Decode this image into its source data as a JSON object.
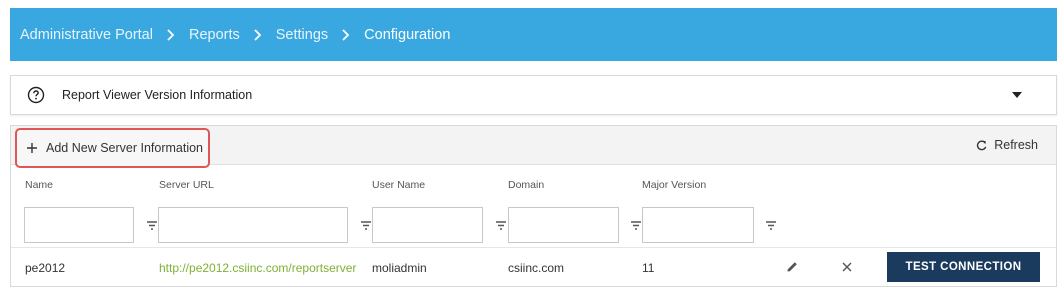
{
  "breadcrumb": {
    "items": [
      {
        "label": "Administrative Portal"
      },
      {
        "label": "Reports"
      },
      {
        "label": "Settings"
      },
      {
        "label": "Configuration"
      }
    ]
  },
  "version_panel": {
    "title": "Report Viewer Version Information",
    "icon": "help-circle-icon",
    "expand_icon": "caret-down-icon"
  },
  "toolbar": {
    "add_label": "Add New Server Information",
    "refresh_label": "Refresh"
  },
  "columns": [
    "Name",
    "Server URL",
    "User Name",
    "Domain",
    "Major Version"
  ],
  "rows": [
    {
      "name": "pe2012",
      "server_url": "http://pe2012.csiinc.com/reportserver",
      "user_name": "moliadmin",
      "domain": "csiinc.com",
      "major_version": "11",
      "action_label": "TEST CONNECTION"
    }
  ],
  "colors": {
    "header_bg": "#3aa8e0",
    "highlight_border": "#e05555",
    "link": "#7fb135",
    "primary_button": "#1a3b5e"
  }
}
